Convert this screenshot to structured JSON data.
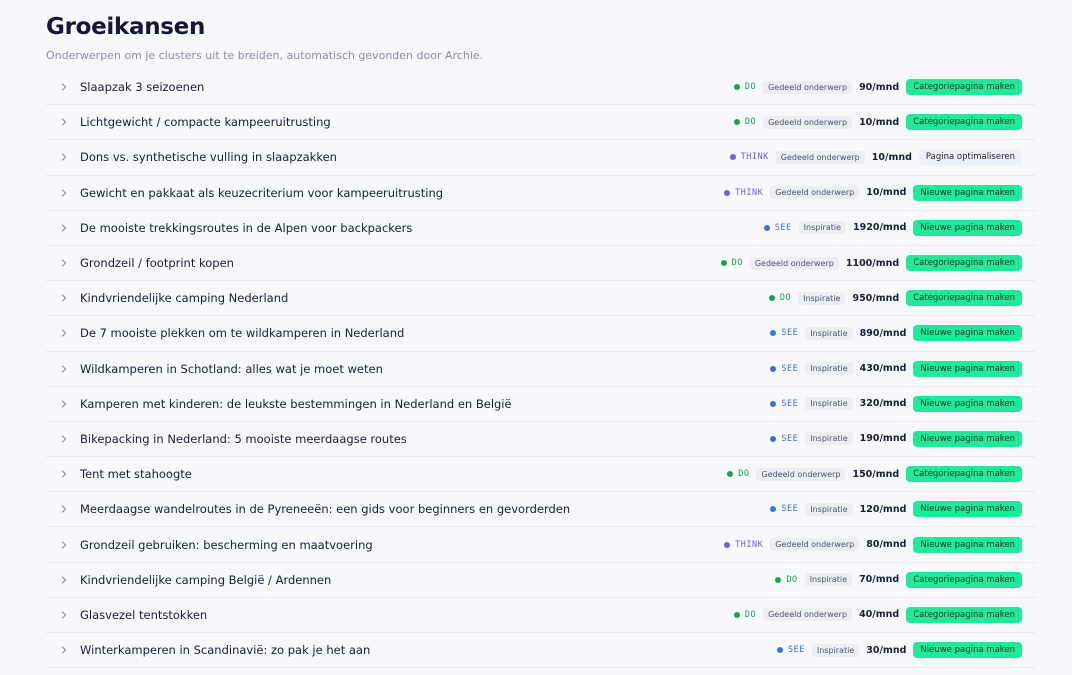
{
  "header": {
    "title": "Groeikansen",
    "subtitle": "Onderwerpen om je clusters uit te breiden, automatisch gevonden door Archie."
  },
  "icons": {
    "expand": "chevron-right-icon",
    "phase": "dot-icon"
  },
  "colors": {
    "do": "#16a34a",
    "think": "#7c5cd6",
    "see": "#3f6fd8",
    "action_green": "#22e89a"
  },
  "rows": [
    {
      "title": "Slaapzak 3 seizoenen",
      "phase": "DO",
      "tag": "Gedeeld onderwerp",
      "volume": "90/mnd",
      "action": "Categoriepagina maken"
    },
    {
      "title": "Lichtgewicht / compacte kampeeruitrusting",
      "phase": "DO",
      "tag": "Gedeeld onderwerp",
      "volume": "10/mnd",
      "action": "Categoriepagina maken"
    },
    {
      "title": "Dons vs. synthetische vulling in slaapzakken",
      "phase": "THINK",
      "tag": "Gedeeld onderwerp",
      "volume": "10/mnd",
      "action": "Pagina optimaliseren"
    },
    {
      "title": "Gewicht en pakkaat als keuzecriterium voor kampeeruitrusting",
      "phase": "THINK",
      "tag": "Gedeeld onderwerp",
      "volume": "10/mnd",
      "action": "Nieuwe pagina maken"
    },
    {
      "title": "De mooiste trekkingsroutes in de Alpen voor backpackers",
      "phase": "SEE",
      "tag": "Inspiratie",
      "volume": "1920/mnd",
      "action": "Nieuwe pagina maken"
    },
    {
      "title": "Grondzeil / footprint kopen",
      "phase": "DO",
      "tag": "Gedeeld onderwerp",
      "volume": "1100/mnd",
      "action": "Categoriepagina maken"
    },
    {
      "title": "Kindvriendelijke camping Nederland",
      "phase": "DO",
      "tag": "Inspiratie",
      "volume": "950/mnd",
      "action": "Categoriepagina maken"
    },
    {
      "title": "De 7 mooiste plekken om te wildkamperen in Nederland",
      "phase": "SEE",
      "tag": "Inspiratie",
      "volume": "890/mnd",
      "action": "Nieuwe pagina maken"
    },
    {
      "title": "Wildkamperen in Schotland: alles wat je moet weten",
      "phase": "SEE",
      "tag": "Inspiratie",
      "volume": "430/mnd",
      "action": "Nieuwe pagina maken"
    },
    {
      "title": "Kamperen met kinderen: de leukste bestemmingen in Nederland en België",
      "phase": "SEE",
      "tag": "Inspiratie",
      "volume": "320/mnd",
      "action": "Nieuwe pagina maken"
    },
    {
      "title": "Bikepacking in Nederland: 5 mooiste meerdaagse routes",
      "phase": "SEE",
      "tag": "Inspiratie",
      "volume": "190/mnd",
      "action": "Nieuwe pagina maken"
    },
    {
      "title": "Tent met stahoogte",
      "phase": "DO",
      "tag": "Gedeeld onderwerp",
      "volume": "150/mnd",
      "action": "Categoriepagina maken"
    },
    {
      "title": "Meerdaagse wandelroutes in de Pyreneeën: een gids voor beginners en gevorderden",
      "phase": "SEE",
      "tag": "Inspiratie",
      "volume": "120/mnd",
      "action": "Nieuwe pagina maken"
    },
    {
      "title": "Grondzeil gebruiken: bescherming en maatvoering",
      "phase": "THINK",
      "tag": "Gedeeld onderwerp",
      "volume": "80/mnd",
      "action": "Nieuwe pagina maken"
    },
    {
      "title": "Kindvriendelijke camping België / Ardennen",
      "phase": "DO",
      "tag": "Inspiratie",
      "volume": "70/mnd",
      "action": "Categoriepagina maken"
    },
    {
      "title": "Glasvezel tentstokken",
      "phase": "DO",
      "tag": "Gedeeld onderwerp",
      "volume": "40/mnd",
      "action": "Categoriepagina maken"
    },
    {
      "title": "Winterkamperen in Scandinavië: zo pak je het aan",
      "phase": "SEE",
      "tag": "Inspiratie",
      "volume": "30/mnd",
      "action": "Nieuwe pagina maken"
    }
  ]
}
